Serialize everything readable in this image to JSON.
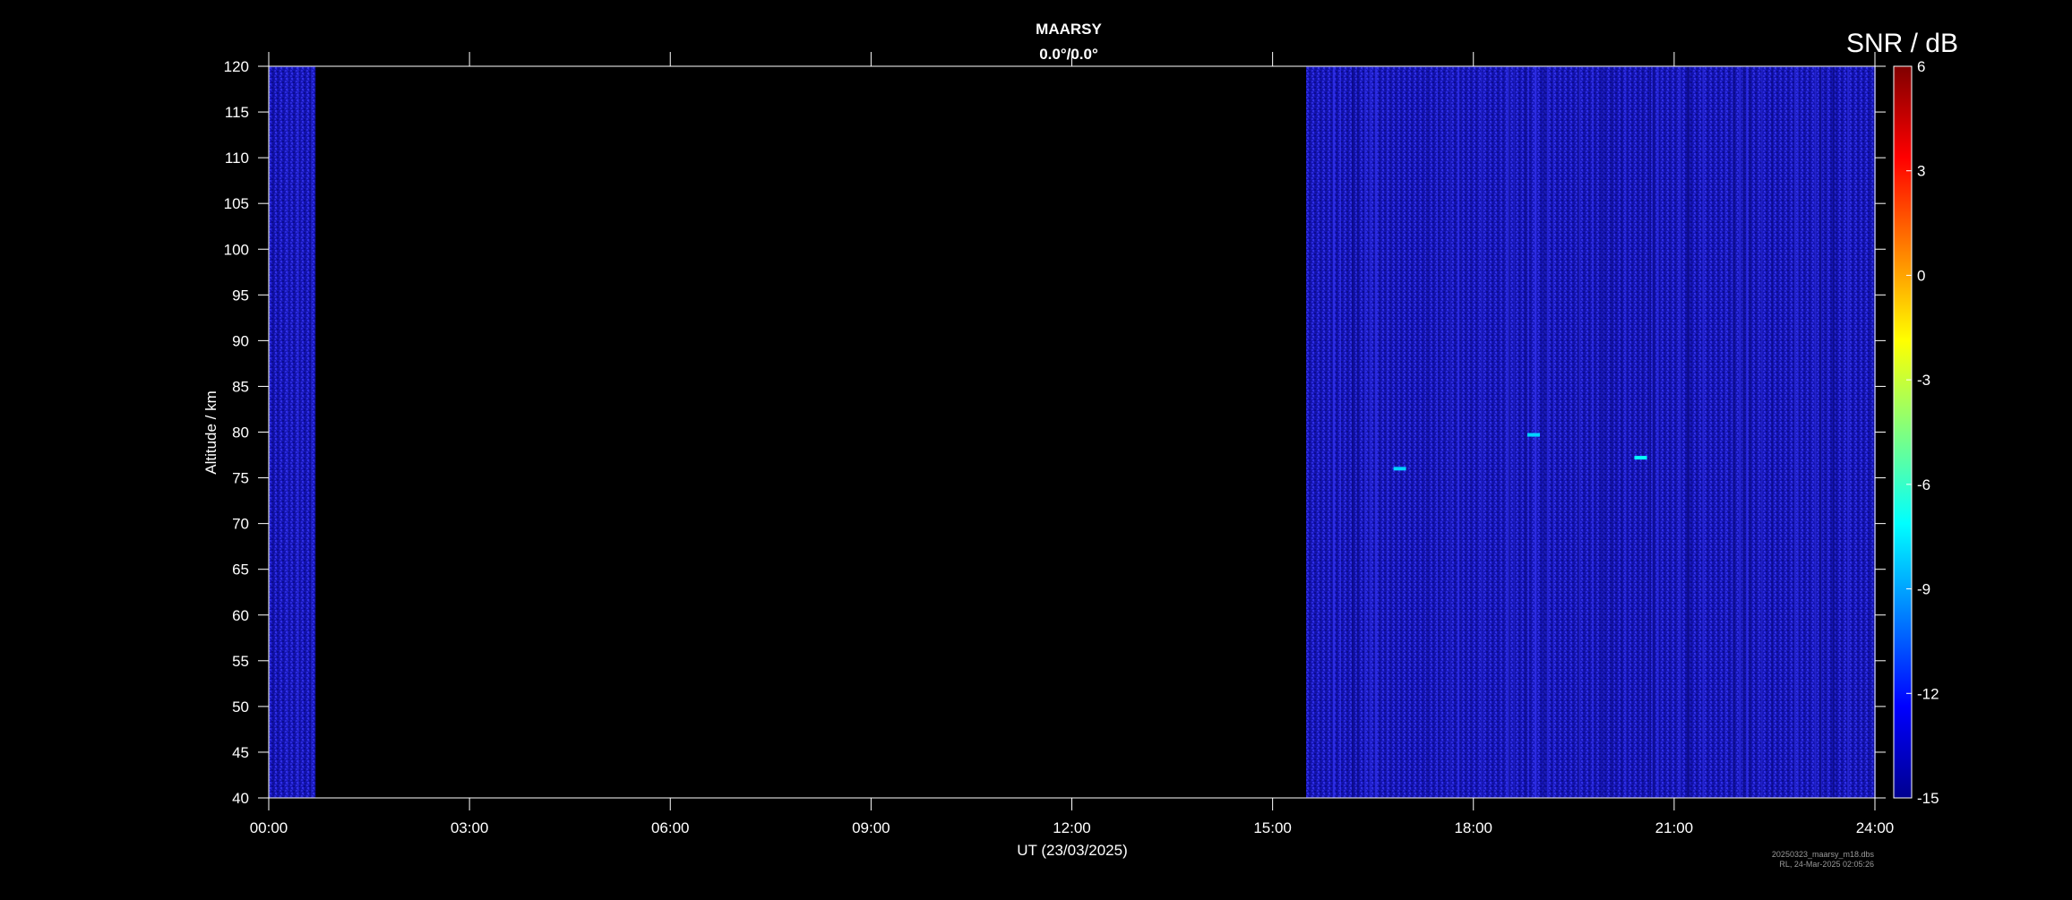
{
  "chart_data": {
    "type": "heatmap",
    "title": "MAARSY",
    "subtitle": "0.0°/0.0°",
    "xlabel": "UT (23/03/2025)",
    "ylabel": "Altitude / km",
    "x_range_hours": [
      0,
      24
    ],
    "x_ticks": [
      "00:00",
      "03:00",
      "06:00",
      "09:00",
      "12:00",
      "15:00",
      "18:00",
      "21:00",
      "24:00"
    ],
    "y_range": [
      40,
      120
    ],
    "y_ticks": [
      40,
      45,
      50,
      55,
      60,
      65,
      70,
      75,
      80,
      85,
      90,
      95,
      100,
      105,
      110,
      115,
      120
    ],
    "colorbar": {
      "label": "SNR / dB",
      "range": [
        -15,
        6
      ],
      "ticks": [
        6,
        3,
        0,
        -3,
        -6,
        -9,
        -12,
        -15
      ],
      "colormap": "jet"
    },
    "data_intervals_hours": [
      {
        "start": 0.0,
        "end": 0.7
      },
      {
        "start": 15.5,
        "end": 24.0
      }
    ],
    "background_snr_db": -13,
    "echoes": [
      {
        "time_h": 16.9,
        "altitude_km": 76.0,
        "snr_db": -8
      },
      {
        "time_h": 18.9,
        "altitude_km": 79.7,
        "snr_db": -8
      },
      {
        "time_h": 20.5,
        "altitude_km": 77.2,
        "snr_db": -7
      }
    ],
    "grid": false
  },
  "footer": {
    "line1": "20250323_maarsy_m18.dbs",
    "line2": "RL, 24-Mar-2025 02:05:26"
  }
}
